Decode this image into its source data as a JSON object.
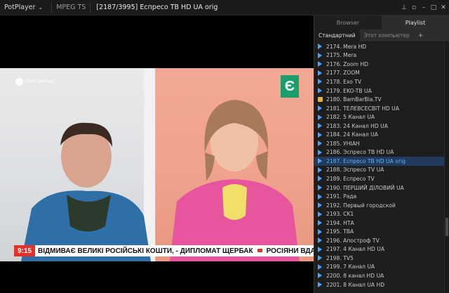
{
  "titlebar": {
    "app_name": "PotPlayer",
    "format": "MPEG TS",
    "file_title": "[2187/3995] Еспресо ТВ HD UA orig"
  },
  "video": {
    "logo_left": "Радіо Свобода",
    "logo_right": "Є",
    "ticker_time": "9:15",
    "ticker_text_1": "ВІДМИВАЄ ВЕЛИКІ РОСІЙСЬКІ КОШТИ, - ДИПЛОМАТ ЩЕРБАК",
    "ticker_text_2": "РОСІЯНИ ВДАР"
  },
  "panel": {
    "tabs": [
      "Browser",
      "Playlist"
    ],
    "sub_tabs": [
      "Стандартний",
      "Этот компьютер",
      "+"
    ],
    "items": [
      {
        "label": "2174. Mera HD",
        "icon": "play"
      },
      {
        "label": "2175. Mera",
        "icon": "play"
      },
      {
        "label": "2176. Zoom HD",
        "icon": "play"
      },
      {
        "label": "2177. ZOOM",
        "icon": "play"
      },
      {
        "label": "2178. Exo TV",
        "icon": "play"
      },
      {
        "label": "2179. EKO-TB UA",
        "icon": "play"
      },
      {
        "label": "2180. BamBarBia.TV",
        "icon": "folder"
      },
      {
        "label": "2181. ТЕЛЕВСЕСВІТ HD UA",
        "icon": "play"
      },
      {
        "label": "2182. 5 Канал UA",
        "icon": "play"
      },
      {
        "label": "2183. 24 Канал HD UA",
        "icon": "play"
      },
      {
        "label": "2184. 24 Канал UA",
        "icon": "play"
      },
      {
        "label": "2185. УНІАН",
        "icon": "play"
      },
      {
        "label": "2186. Эспресо ТВ HD UA",
        "icon": "play"
      },
      {
        "label": "2187. Еспресо ТВ HD UA orig",
        "icon": "play",
        "current": true
      },
      {
        "label": "2188. Эспресо TV UA",
        "icon": "play"
      },
      {
        "label": "2189. Еспресо TV",
        "icon": "play"
      },
      {
        "label": "2190. ПЕРШИЙ ДІЛОВИЙ UA",
        "icon": "play"
      },
      {
        "label": "2191. Рада",
        "icon": "play"
      },
      {
        "label": "2192. Первый городской",
        "icon": "play"
      },
      {
        "label": "2193. CK1",
        "icon": "play"
      },
      {
        "label": "2194. НТА",
        "icon": "play"
      },
      {
        "label": "2195. ТВА",
        "icon": "play"
      },
      {
        "label": "2196. Апостроф TV",
        "icon": "play"
      },
      {
        "label": "2197. 4 Канал HD UA",
        "icon": "play"
      },
      {
        "label": "2198. TV5",
        "icon": "play"
      },
      {
        "label": "2199. 7 Канал UA",
        "icon": "play"
      },
      {
        "label": "2200. 8 канал HD UA",
        "icon": "play"
      },
      {
        "label": "2201. 8 Канал UA HD",
        "icon": "play"
      }
    ]
  }
}
